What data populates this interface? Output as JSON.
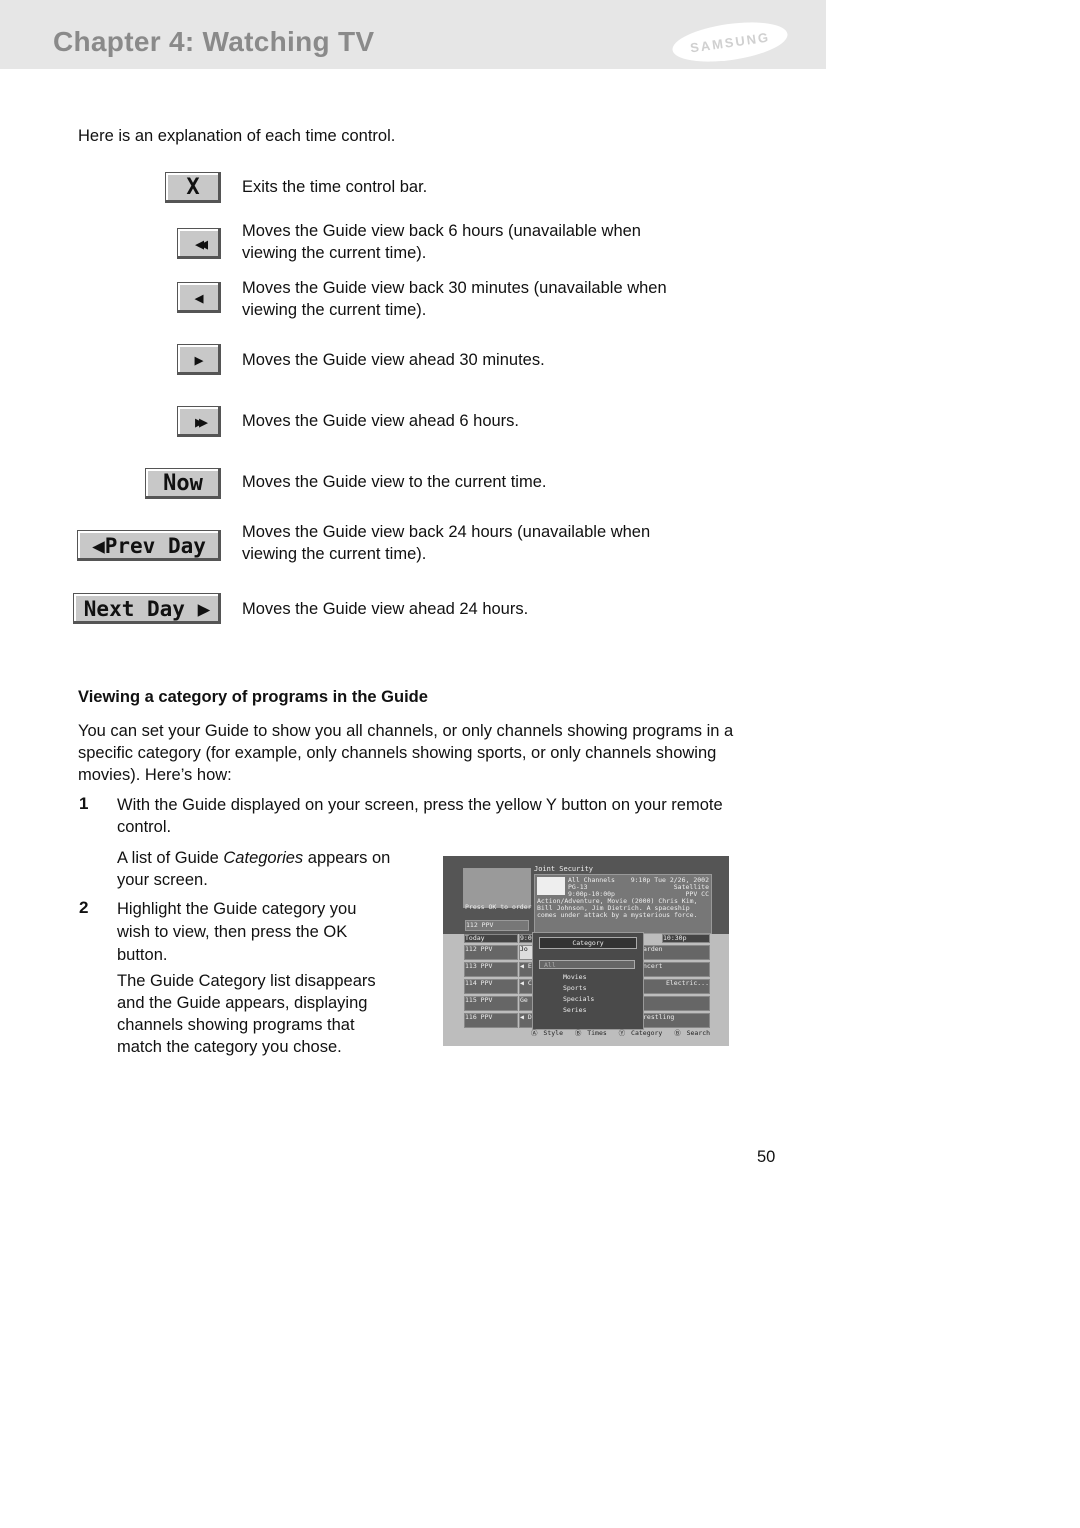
{
  "header": {
    "title": "Chapter 4: Watching TV",
    "logo": "SAMSUNG"
  },
  "intro": "Here is an explanation of each time control.",
  "controls": [
    {
      "icon": "close-icon",
      "label": "X",
      "text": "Exits the time control bar."
    },
    {
      "icon": "rewind-6h-icon",
      "label": "◀◀",
      "text": "Moves the Guide view back 6 hours (unavailable when viewing the current time)."
    },
    {
      "icon": "back-30min-icon",
      "label": "◀",
      "text": "Moves the Guide view back 30 minutes (unavailable when viewing the current time)."
    },
    {
      "icon": "ahead-30min-icon",
      "label": "▶",
      "text": "Moves the Guide view ahead 30 minutes."
    },
    {
      "icon": "forward-6h-icon",
      "label": "▶▶",
      "text": "Moves the Guide view ahead 6 hours."
    },
    {
      "icon": "now-button",
      "label": "Now",
      "text": "Moves the Guide view to the current time."
    },
    {
      "icon": "prev-day-button",
      "label": "◀Prev Day",
      "text": "Moves the Guide view back 24 hours (unavailable when viewing the current time)."
    },
    {
      "icon": "next-day-button",
      "label": "Next Day ▶",
      "text": "Moves the Guide view ahead 24 hours."
    }
  ],
  "section": {
    "heading": "Viewing a category of programs in the Guide",
    "para": "You can set your Guide to show you all channels, or only channels showing programs in a specific category (for example, only channels showing sports, or only channels showing movies). Here’s how:",
    "step1_num": "1",
    "step1": "With the Guide displayed on your screen, press the yellow Y button on your remote control.",
    "step1_sub_a": "A list of Guide ",
    "step1_sub_em": "Categories",
    "step1_sub_b": " appears on your screen.",
    "step2_num": "2",
    "step2": "Highlight the Guide category you wish to view, then press the OK button.",
    "step2_sub": "The Guide Category list disappears and the Guide appears, displaying channels showing programs that match the category you chose."
  },
  "tv": {
    "program_title": "Joint Security",
    "channels": "All Channels",
    "rating": "PG-13",
    "time": "9:00p-10:00p",
    "datetime": "9:10p Tue 2/26, 2002",
    "source": "Satellite",
    "flags": "PPV CC",
    "desc": "Action/Adventure, Movie (2000) Chris Kim, Bill Johnson, Jim Dietrich. A spaceship comes under attack by a mysterious force.",
    "press_ok": "Press OK to order",
    "preview_ch": "112   PPV",
    "today": "Today",
    "col1": "9:0",
    "col2": "10:30p",
    "channels_list": [
      "112 PPV",
      "113 PPV",
      "114 PPV",
      "115 PPV",
      "116 PPV"
    ],
    "left_cells": [
      "Jo",
      "◀ E",
      "◀ C",
      "Ge",
      "◀ D"
    ],
    "right_cells": [
      "arden",
      "ncert",
      "Electric...",
      "",
      "restling"
    ],
    "menu_title": "Category",
    "menu_items": [
      "All",
      "Movies",
      "Sports",
      "Specials",
      "Series"
    ],
    "footer": [
      "Ⓐ Style",
      "Ⓑ Times",
      "Ⓨ Category",
      "Ⓑ Search"
    ]
  },
  "page_number": "50"
}
